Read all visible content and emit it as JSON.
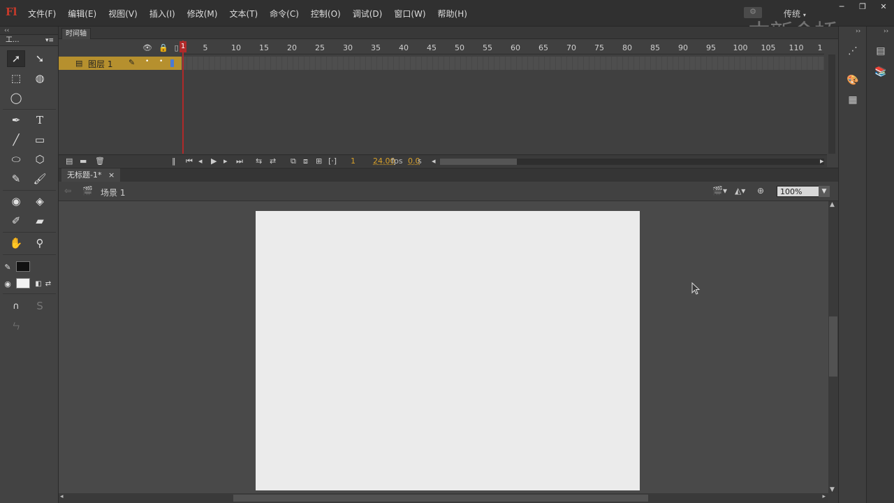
{
  "app": {
    "logo": "Fl"
  },
  "menu": [
    "文件(F)",
    "编辑(E)",
    "视图(V)",
    "插入(I)",
    "修改(M)",
    "文本(T)",
    "命令(C)",
    "控制(O)",
    "调试(D)",
    "窗口(W)",
    "帮助(H)"
  ],
  "workspace": "传统",
  "watermark": "中新金桥",
  "tools": {
    "panel_title": "工..."
  },
  "timeline": {
    "tab": "时间轴",
    "ruler": [
      "1",
      "5",
      "10",
      "15",
      "20",
      "25",
      "30",
      "35",
      "40",
      "45",
      "50",
      "55",
      "60",
      "65",
      "70",
      "75",
      "80",
      "85",
      "90",
      "95",
      "100",
      "105",
      "110",
      "1"
    ],
    "layer_name": "图层 1",
    "current_frame": "1",
    "fps": "24.00",
    "fps_unit": "fps",
    "time": "0.0",
    "time_unit": "s"
  },
  "document": {
    "tab": "无标题-1*",
    "close": "×",
    "scene": "场景 1",
    "zoom": "100%"
  }
}
